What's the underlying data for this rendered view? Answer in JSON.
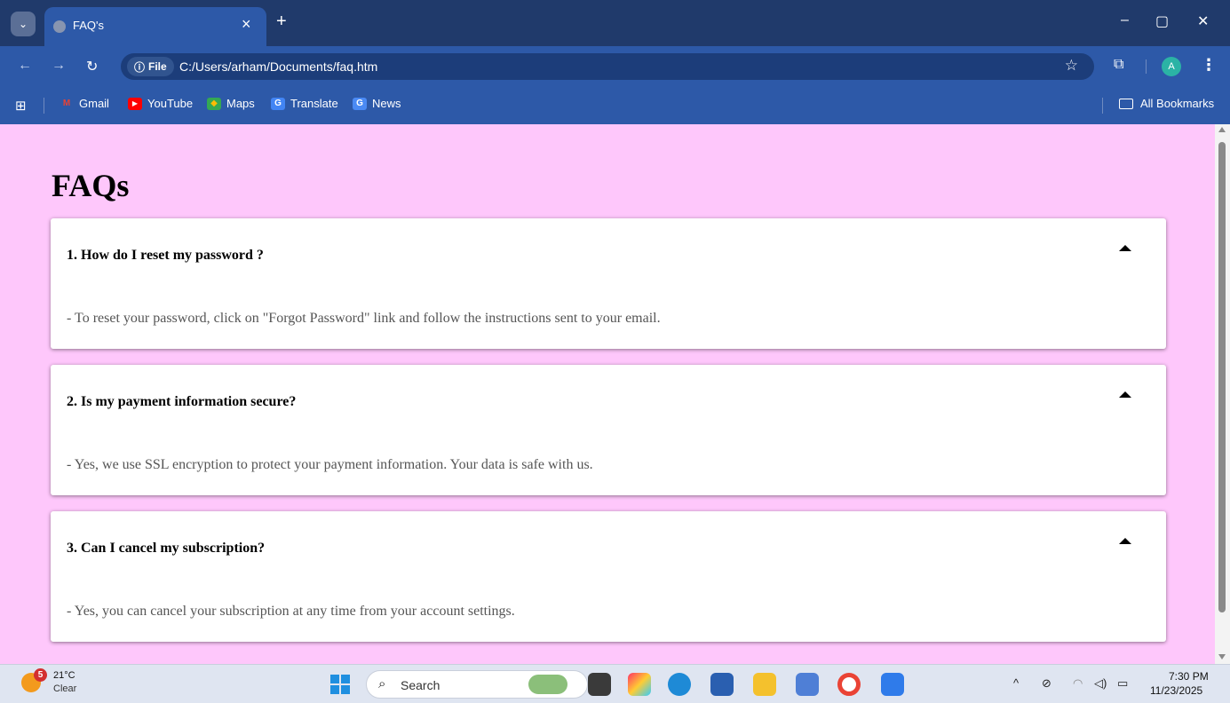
{
  "browser": {
    "tab_title": "FAQ's",
    "tab_close": "×",
    "new_tab": "+",
    "url_scheme_label": "File",
    "url": "C:/Users/arham/Documents/faq.htm",
    "profile_initial": "A",
    "window_controls": [
      "–",
      "▢",
      "✕"
    ]
  },
  "bookmarks": {
    "items": [
      {
        "label": "Gmail",
        "icon": "gmail-icon",
        "color": "#e94235"
      },
      {
        "label": "YouTube",
        "icon": "youtube-icon",
        "color": "#ff0000"
      },
      {
        "label": "Maps",
        "icon": "maps-icon",
        "color": "#34a853"
      },
      {
        "label": "Translate",
        "icon": "translate-icon",
        "color": "#4285f4"
      },
      {
        "label": "News",
        "icon": "news-icon",
        "color": "#4a8af4"
      }
    ],
    "all_bookmarks": "All Bookmarks"
  },
  "page": {
    "background": "#fec7fb",
    "title": "FAQs",
    "faqs": [
      {
        "question": "1. How do I reset my password ?",
        "answer": "- To reset your password, click on \"Forgot Password\" link and follow the instructions sent to your email."
      },
      {
        "question": "2. Is my payment information secure?",
        "answer": "- Yes, we use SSL encryption to protect your payment information. Your data is safe with us."
      },
      {
        "question": "3. Can I cancel my subscription?",
        "answer": "- Yes, you can cancel your subscription at any time from your account settings."
      }
    ]
  },
  "taskbar": {
    "weather_badge": "5",
    "temperature": "21°C",
    "condition": "Clear",
    "search_label": "Search",
    "time": "7:30 PM",
    "date": "11/23/2025"
  }
}
